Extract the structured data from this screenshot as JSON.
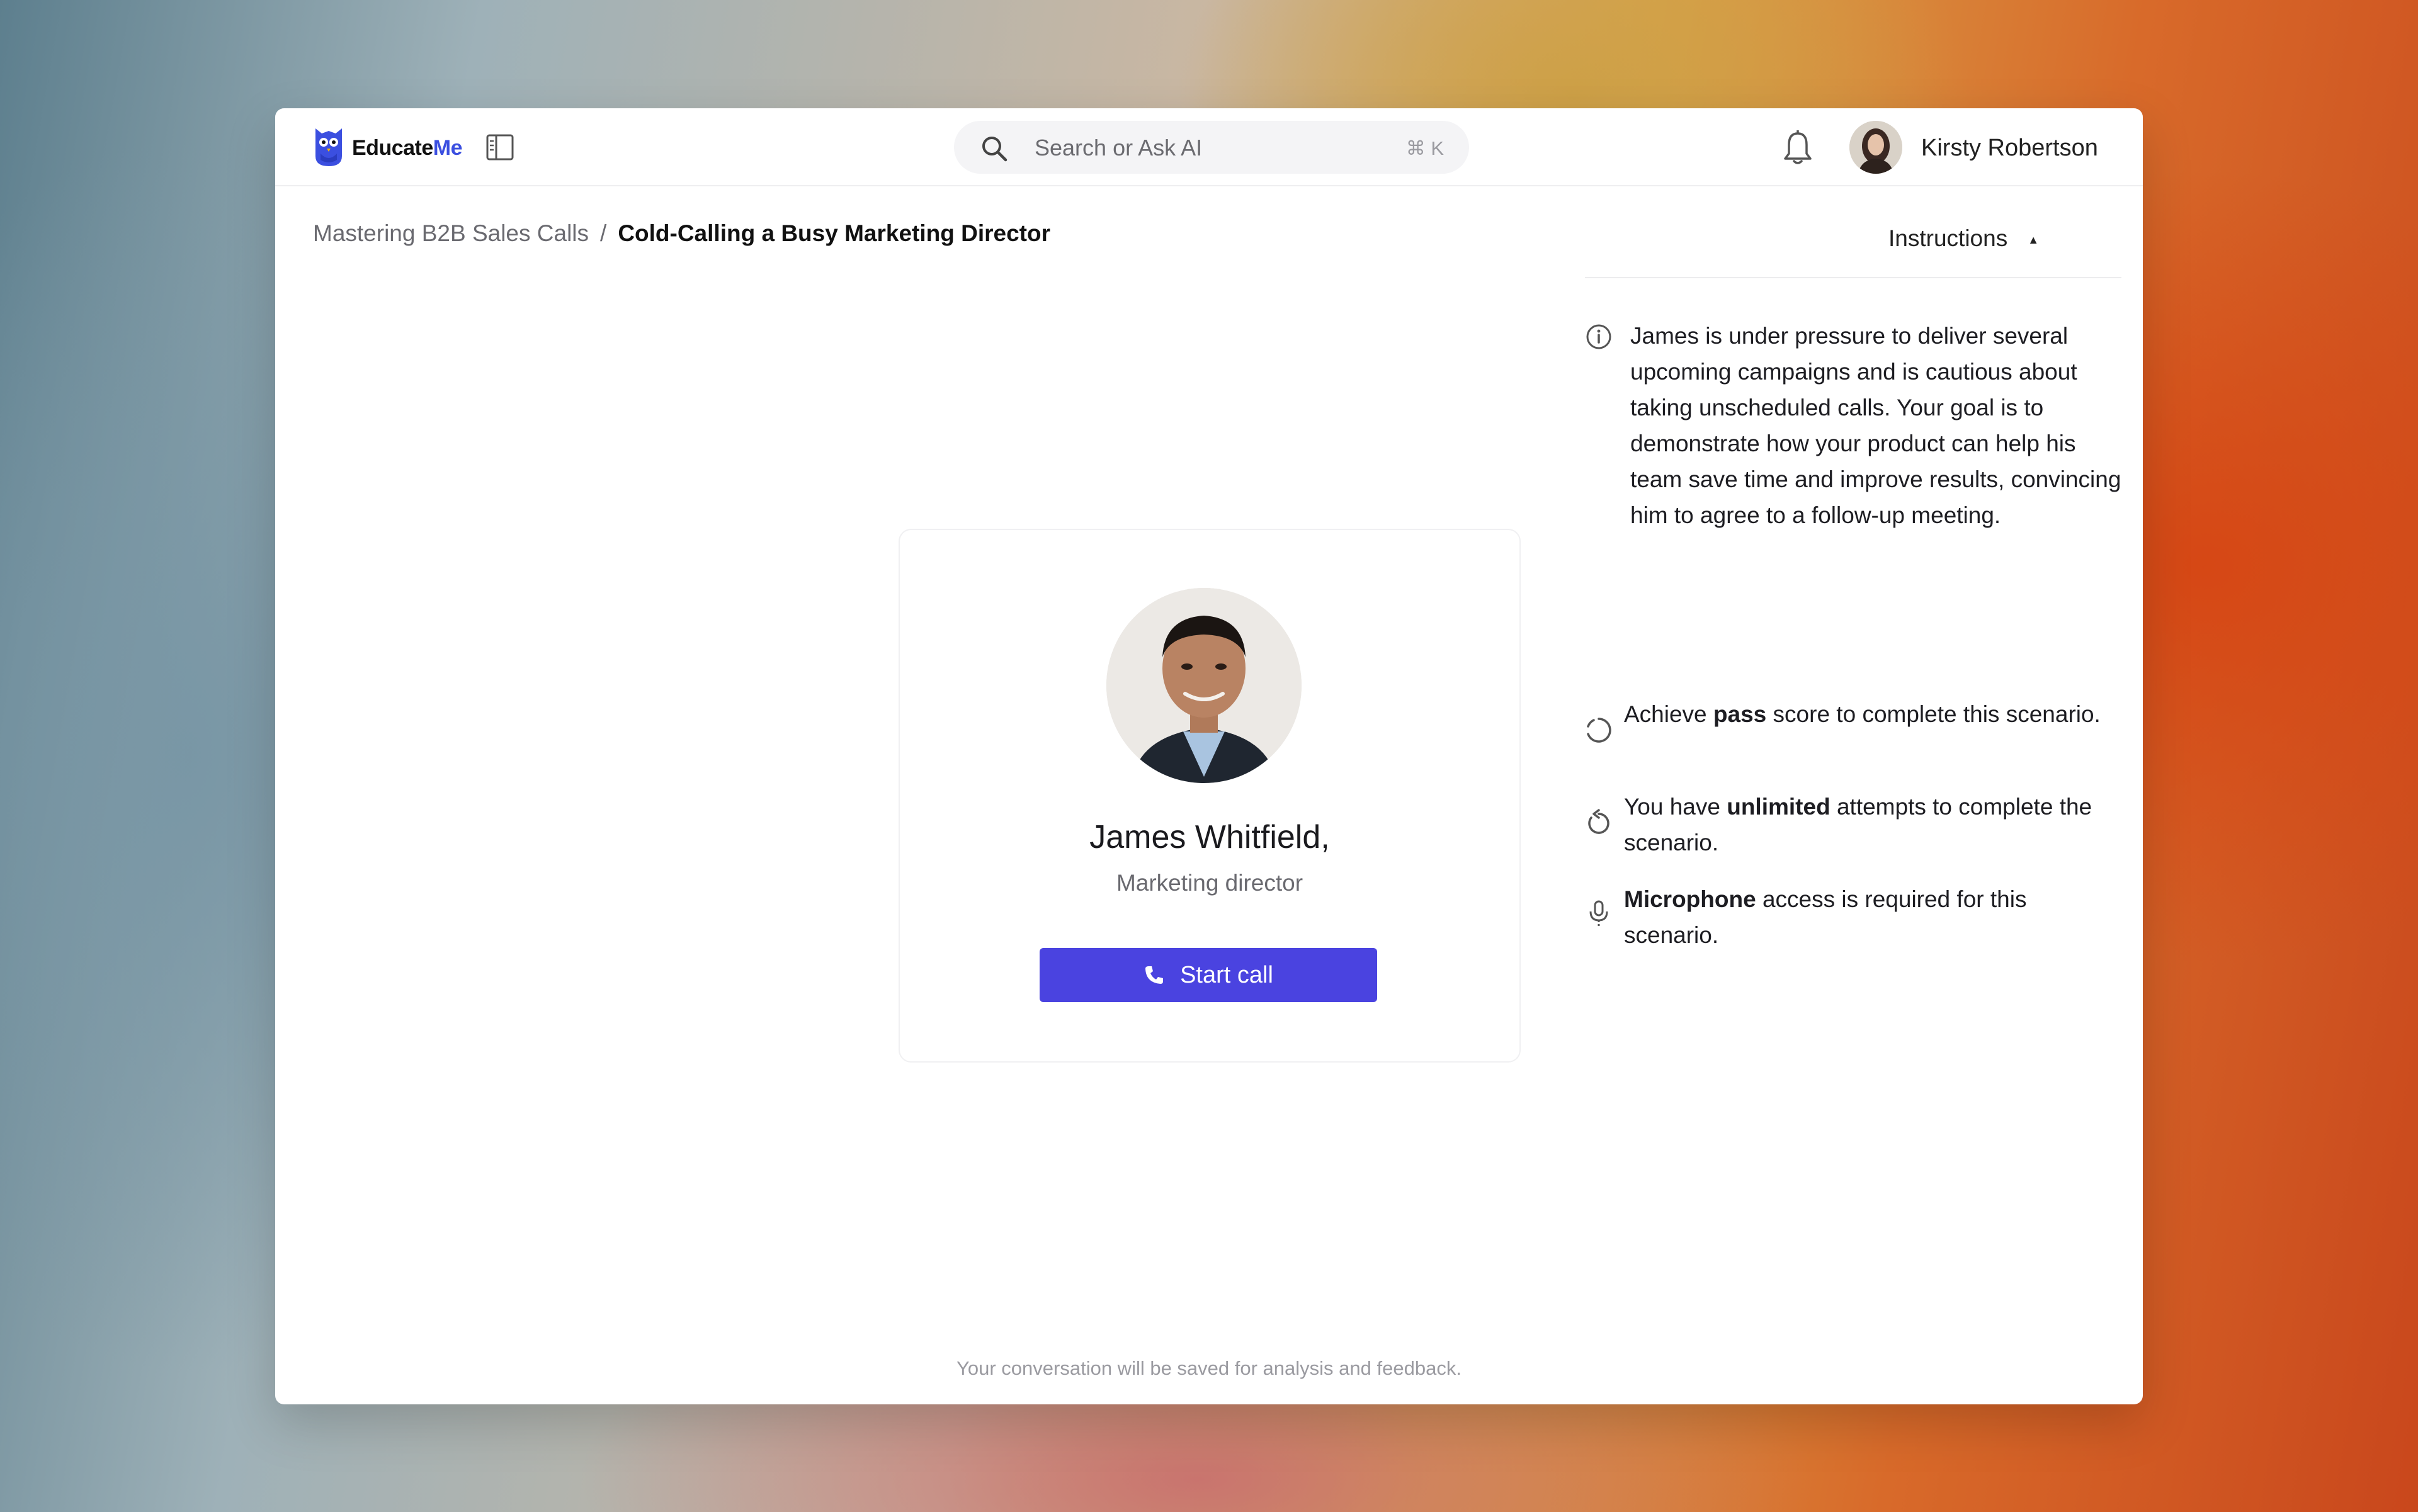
{
  "app": {
    "brand_part1": "Educate",
    "brand_part2": "Me"
  },
  "search": {
    "placeholder": "Search or Ask AI",
    "shortcut": "⌘ K"
  },
  "user": {
    "name": "Kirsty Robertson"
  },
  "breadcrumb": {
    "parent": "Mastering B2B Sales Calls",
    "separator": "/",
    "current": "Cold-Calling a Busy Marketing Director"
  },
  "instructions": {
    "toggle_label": "Instructions",
    "items": [
      {
        "icon": "info-icon",
        "text_plain": "James is under pressure to deliver several upcoming campaigns and is cautious about taking unscheduled calls. Your goal is to demonstrate how your product can help his team save time and improve results, convincing him to agree to a follow-up meeting."
      },
      {
        "icon": "progress-circle-icon",
        "prefix": "Achieve ",
        "bold": "pass",
        "suffix": " score to complete this scenario."
      },
      {
        "icon": "retry-icon",
        "prefix": "You have ",
        "bold": "unlimited",
        "suffix": " attempts to complete the scenario."
      },
      {
        "icon": "microphone-icon",
        "prefix": "",
        "bold": "Microphone",
        "suffix": " access is required for this scenario."
      }
    ]
  },
  "persona": {
    "name": "James Whitfield,",
    "role": "Marketing director",
    "call_button": "Start call"
  },
  "footer": {
    "note": "Your conversation will be saved for analysis and feedback."
  },
  "colors": {
    "accent": "#4a43e0",
    "brand_blue": "#3b4fe0"
  }
}
